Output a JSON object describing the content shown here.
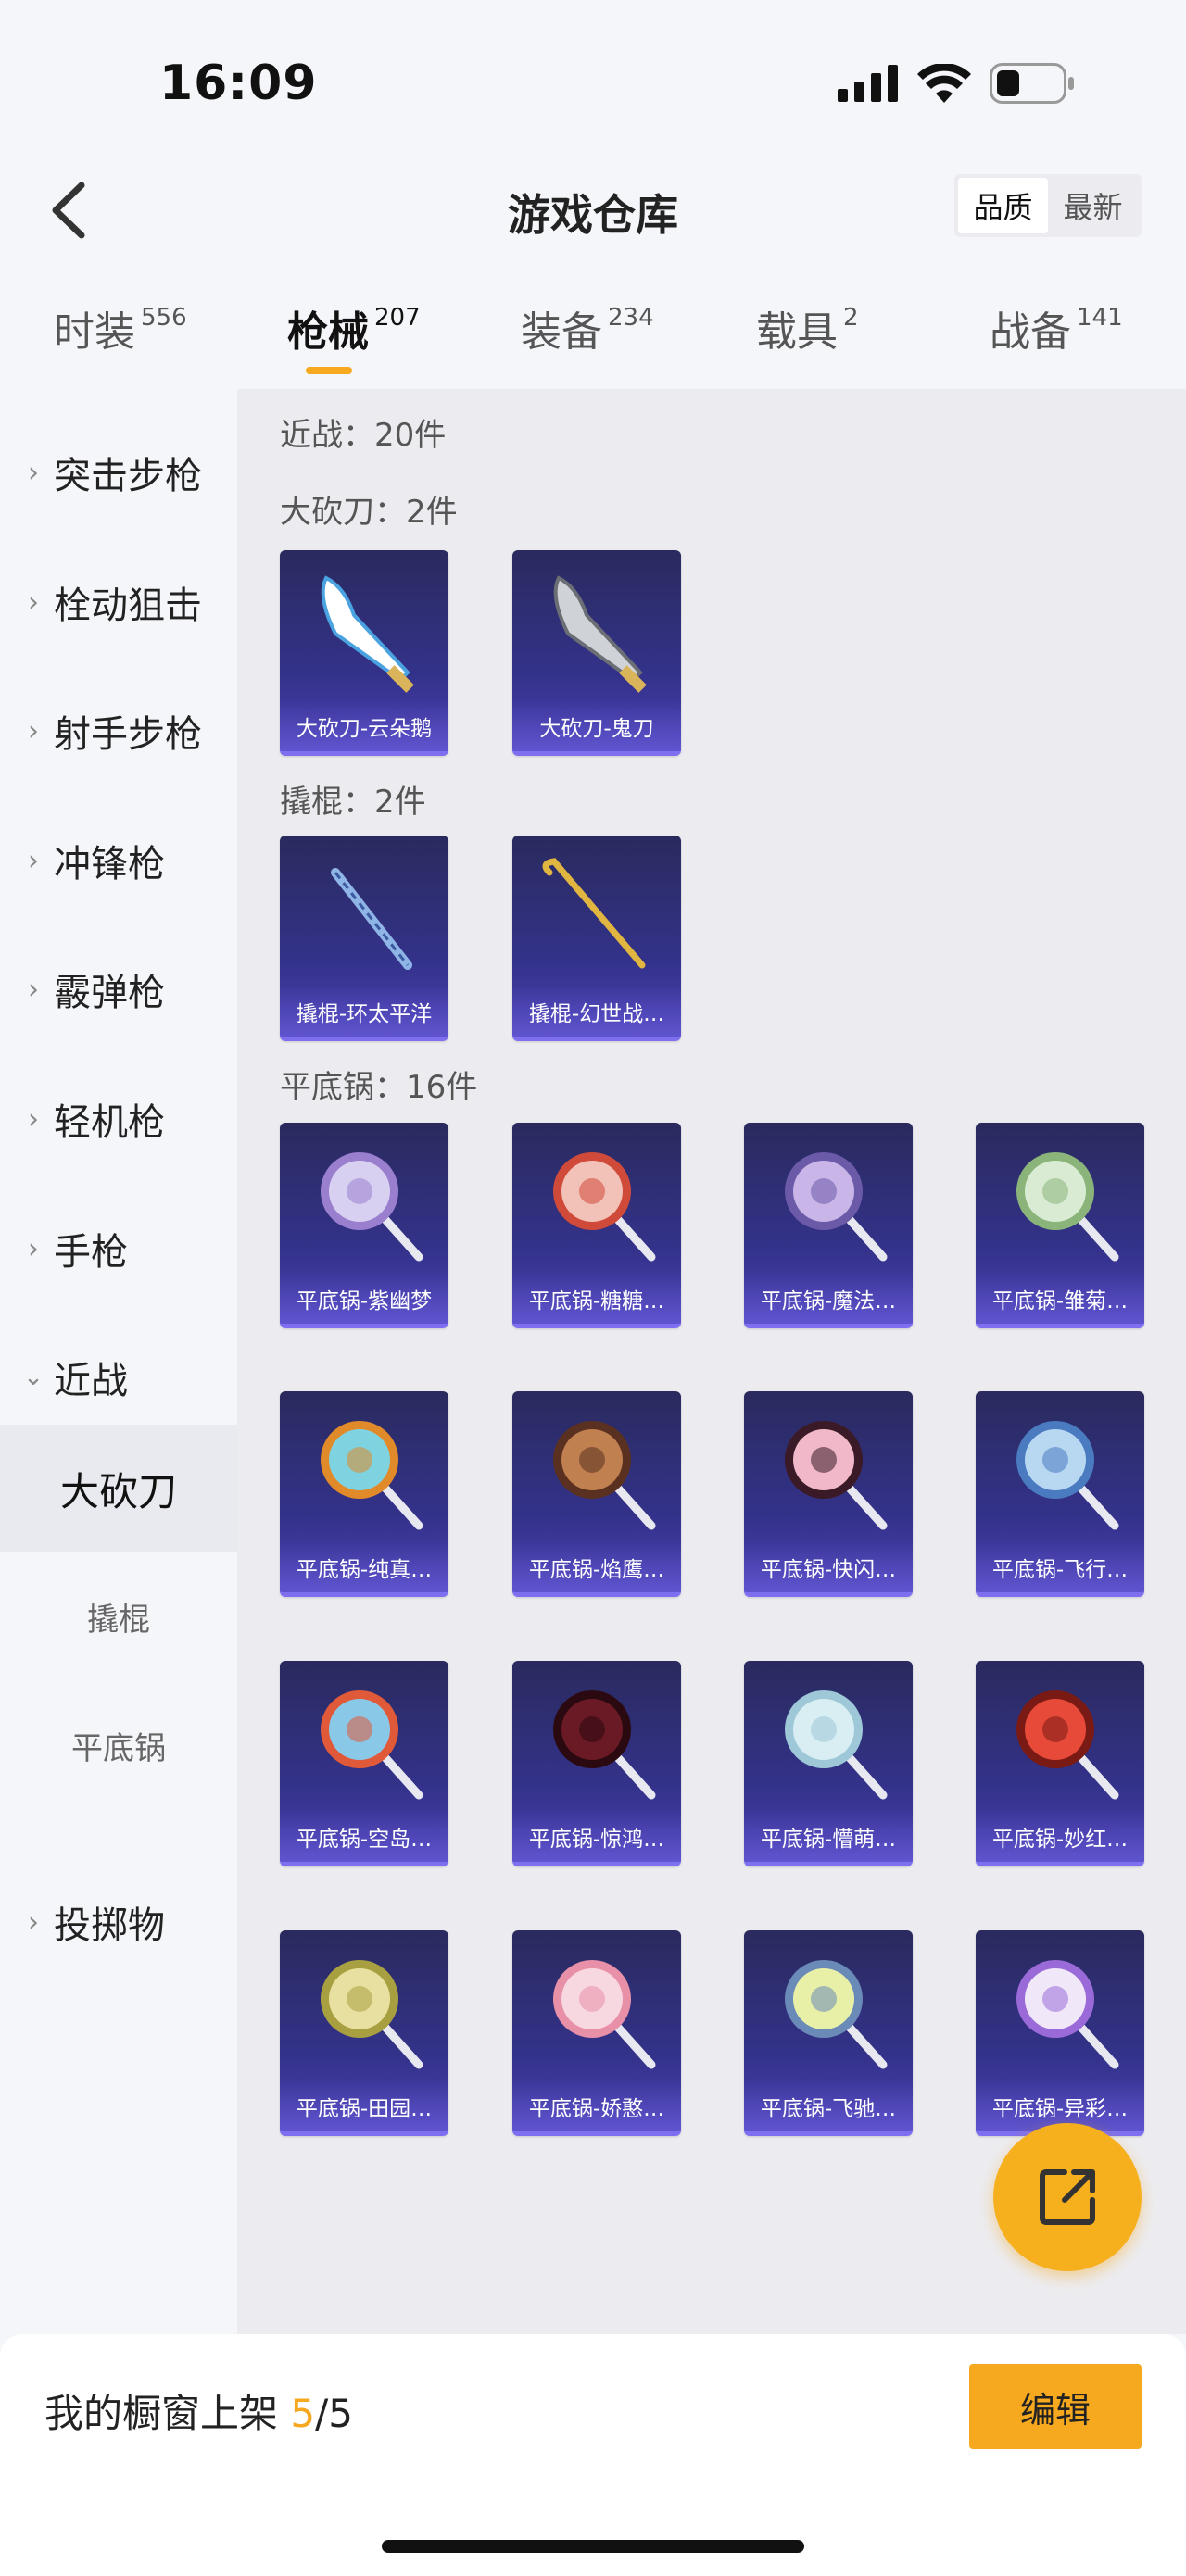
{
  "status_bar": {
    "time": "16:09"
  },
  "header": {
    "title": "游戏仓库",
    "sort_options": [
      "品质",
      "最新"
    ],
    "active_sort": "品质"
  },
  "tabs": [
    {
      "label": "时装",
      "count": "556"
    },
    {
      "label": "枪械",
      "count": "207",
      "active": true
    },
    {
      "label": "装备",
      "count": "234"
    },
    {
      "label": "载具",
      "count": "2"
    },
    {
      "label": "战备",
      "count": "141"
    }
  ],
  "sidebar": {
    "categories": [
      "突击步枪",
      "栓动狙击",
      "射手步枪",
      "冲锋枪",
      "霰弹枪",
      "轻机枪",
      "手枪",
      "近战",
      "投掷物"
    ],
    "subcategories": [
      "大砍刀",
      "撬棍",
      "平底锅"
    ],
    "active_subcategory": "大砍刀"
  },
  "content": {
    "summary": "近战：20件",
    "sections": [
      {
        "title": "大砍刀：2件",
        "items": [
          "大砍刀-云朵鹅",
          "大砍刀-鬼刀"
        ]
      },
      {
        "title": "撬棍：2件",
        "items": [
          "撬棍-环太平洋",
          "撬棍-幻世战…"
        ]
      },
      {
        "title": "平底锅：16件",
        "items": [
          "平底锅-紫幽梦",
          "平底锅-糖糖…",
          "平底锅-魔法…",
          "平底锅-雏菊…",
          "平底锅-纯真…",
          "平底锅-焰鹰…",
          "平底锅-快闪…",
          "平底锅-飞行…",
          "平底锅-空岛…",
          "平底锅-惊鸿…",
          "平底锅-懵萌…",
          "平底锅-妙红…",
          "平底锅-田园…",
          "平底锅-娇憨…",
          "平底锅-飞驰…",
          "平底锅-异彩…"
        ]
      }
    ]
  },
  "bottom_bar": {
    "label_prefix": "我的橱窗上架 ",
    "shelf_used": "5",
    "shelf_total": "/5",
    "edit_label": "编辑"
  },
  "colors": {
    "accent": "#f6a81e",
    "card_top": "#2a2a5e",
    "card_bottom": "#4a3fb3"
  },
  "icons": [
    "back-arrow-icon",
    "signal-icon",
    "wifi-icon",
    "battery-icon",
    "chevron-right-icon",
    "chevron-down-icon",
    "share-out-icon"
  ]
}
